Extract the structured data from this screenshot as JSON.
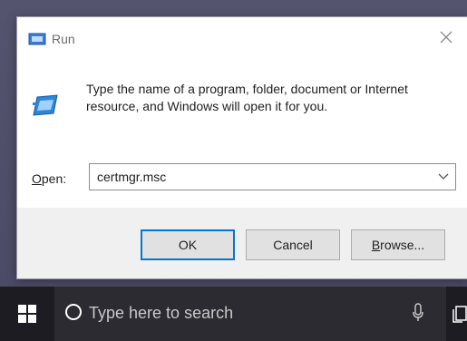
{
  "dialog": {
    "title": "Run",
    "message": "Type the name of a program, folder, document or Internet resource, and Windows will open it for you.",
    "open_label_access": "O",
    "open_label_rest": "pen:",
    "open_value": "certmgr.msc",
    "buttons": {
      "ok": "OK",
      "cancel": "Cancel",
      "browse_access": "B",
      "browse_rest": "rowse..."
    }
  },
  "taskbar": {
    "search_placeholder": "Type here to search"
  },
  "icons": {
    "title": "run-icon",
    "app": "run-app-icon",
    "close": "close-icon",
    "dropdown": "chevron-down-icon",
    "start": "windows-start-icon",
    "search": "cortana-search-icon",
    "mic": "microphone-icon",
    "taskview": "task-view-icon"
  },
  "colors": {
    "accent": "#0078d7",
    "desktop": "#4e4f6a",
    "taskbar": "#1c1c22"
  }
}
